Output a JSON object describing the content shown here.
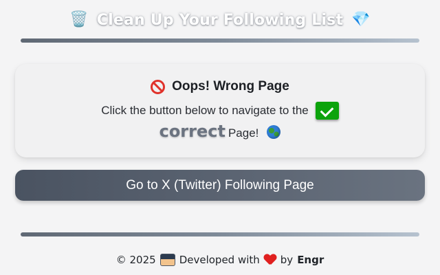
{
  "header": {
    "title": "Clean Up Your Following List",
    "left_emoji": "🗑️",
    "right_emoji": "💎"
  },
  "card": {
    "heading": "Oops! Wrong Page",
    "heading_icon": "no-entry-icon",
    "line1": "Click the button below to navigate to the",
    "line1_icon": "check-box-icon",
    "emphasis": "correct",
    "line2_rest": "Page!",
    "line2_icon": "globe-icon"
  },
  "button": {
    "label": "Go to X (Twitter) Following Page"
  },
  "footer": {
    "copyright": "© 2025",
    "developed_with": "Developed with",
    "by": "by",
    "author": "Engr"
  },
  "colors": {
    "button_bg": "#5a6370",
    "rule_start": "#5f6874",
    "rule_end": "#b6c2cf",
    "check_green": "#0ca30c",
    "heart_red": "#e0201f"
  }
}
